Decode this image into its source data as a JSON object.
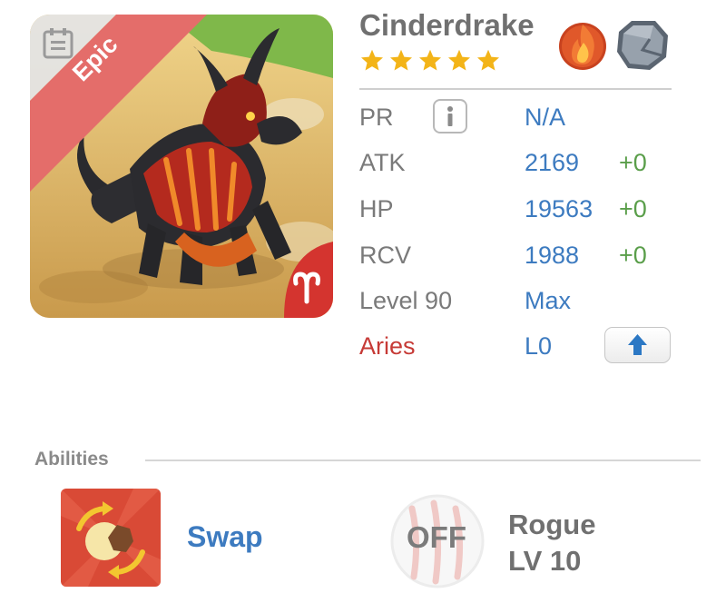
{
  "creature": {
    "name": "Cinderdrake",
    "rarity": "Epic",
    "stars": 5,
    "elements": [
      "fire-element-icon",
      "stone-element-icon"
    ]
  },
  "stats": {
    "pr_label": "PR",
    "pr_value": "N/A",
    "atk_label": "ATK",
    "atk_value": "2169",
    "atk_bonus": "+0",
    "hp_label": "HP",
    "hp_value": "19563",
    "hp_bonus": "+0",
    "rcv_label": "RCV",
    "rcv_value": "1988",
    "rcv_bonus": "+0",
    "level_label": "Level 90",
    "level_value": "Max",
    "sign_label": "Aries",
    "sign_level": "L0"
  },
  "abilities": {
    "title": "Abilities",
    "active_name": "Swap",
    "passive_state": "OFF",
    "passive_name": "Rogue",
    "passive_level": "LV 10"
  },
  "colors": {
    "value_blue": "#3d7bc0",
    "bonus_green": "#5a9e4a",
    "aries_red": "#c63a36",
    "epic_banner": "#e46d6a",
    "star_gold": "#f3b418"
  }
}
